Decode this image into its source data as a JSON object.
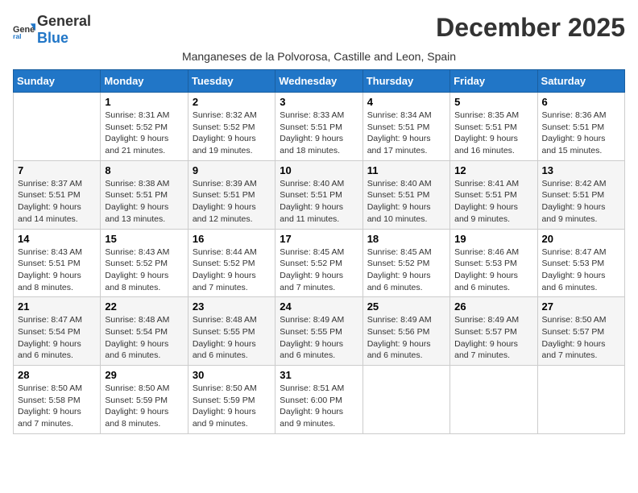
{
  "logo": {
    "general": "General",
    "blue": "Blue"
  },
  "title": "December 2025",
  "subtitle": "Manganeses de la Polvorosa, Castille and Leon, Spain",
  "days_header": [
    "Sunday",
    "Monday",
    "Tuesday",
    "Wednesday",
    "Thursday",
    "Friday",
    "Saturday"
  ],
  "weeks": [
    [
      {
        "day": "",
        "sunrise": "",
        "sunset": "",
        "daylight": ""
      },
      {
        "day": "1",
        "sunrise": "Sunrise: 8:31 AM",
        "sunset": "Sunset: 5:52 PM",
        "daylight": "Daylight: 9 hours and 21 minutes."
      },
      {
        "day": "2",
        "sunrise": "Sunrise: 8:32 AM",
        "sunset": "Sunset: 5:52 PM",
        "daylight": "Daylight: 9 hours and 19 minutes."
      },
      {
        "day": "3",
        "sunrise": "Sunrise: 8:33 AM",
        "sunset": "Sunset: 5:51 PM",
        "daylight": "Daylight: 9 hours and 18 minutes."
      },
      {
        "day": "4",
        "sunrise": "Sunrise: 8:34 AM",
        "sunset": "Sunset: 5:51 PM",
        "daylight": "Daylight: 9 hours and 17 minutes."
      },
      {
        "day": "5",
        "sunrise": "Sunrise: 8:35 AM",
        "sunset": "Sunset: 5:51 PM",
        "daylight": "Daylight: 9 hours and 16 minutes."
      },
      {
        "day": "6",
        "sunrise": "Sunrise: 8:36 AM",
        "sunset": "Sunset: 5:51 PM",
        "daylight": "Daylight: 9 hours and 15 minutes."
      }
    ],
    [
      {
        "day": "7",
        "sunrise": "Sunrise: 8:37 AM",
        "sunset": "Sunset: 5:51 PM",
        "daylight": "Daylight: 9 hours and 14 minutes."
      },
      {
        "day": "8",
        "sunrise": "Sunrise: 8:38 AM",
        "sunset": "Sunset: 5:51 PM",
        "daylight": "Daylight: 9 hours and 13 minutes."
      },
      {
        "day": "9",
        "sunrise": "Sunrise: 8:39 AM",
        "sunset": "Sunset: 5:51 PM",
        "daylight": "Daylight: 9 hours and 12 minutes."
      },
      {
        "day": "10",
        "sunrise": "Sunrise: 8:40 AM",
        "sunset": "Sunset: 5:51 PM",
        "daylight": "Daylight: 9 hours and 11 minutes."
      },
      {
        "day": "11",
        "sunrise": "Sunrise: 8:40 AM",
        "sunset": "Sunset: 5:51 PM",
        "daylight": "Daylight: 9 hours and 10 minutes."
      },
      {
        "day": "12",
        "sunrise": "Sunrise: 8:41 AM",
        "sunset": "Sunset: 5:51 PM",
        "daylight": "Daylight: 9 hours and 9 minutes."
      },
      {
        "day": "13",
        "sunrise": "Sunrise: 8:42 AM",
        "sunset": "Sunset: 5:51 PM",
        "daylight": "Daylight: 9 hours and 9 minutes."
      }
    ],
    [
      {
        "day": "14",
        "sunrise": "Sunrise: 8:43 AM",
        "sunset": "Sunset: 5:51 PM",
        "daylight": "Daylight: 9 hours and 8 minutes."
      },
      {
        "day": "15",
        "sunrise": "Sunrise: 8:43 AM",
        "sunset": "Sunset: 5:52 PM",
        "daylight": "Daylight: 9 hours and 8 minutes."
      },
      {
        "day": "16",
        "sunrise": "Sunrise: 8:44 AM",
        "sunset": "Sunset: 5:52 PM",
        "daylight": "Daylight: 9 hours and 7 minutes."
      },
      {
        "day": "17",
        "sunrise": "Sunrise: 8:45 AM",
        "sunset": "Sunset: 5:52 PM",
        "daylight": "Daylight: 9 hours and 7 minutes."
      },
      {
        "day": "18",
        "sunrise": "Sunrise: 8:45 AM",
        "sunset": "Sunset: 5:52 PM",
        "daylight": "Daylight: 9 hours and 6 minutes."
      },
      {
        "day": "19",
        "sunrise": "Sunrise: 8:46 AM",
        "sunset": "Sunset: 5:53 PM",
        "daylight": "Daylight: 9 hours and 6 minutes."
      },
      {
        "day": "20",
        "sunrise": "Sunrise: 8:47 AM",
        "sunset": "Sunset: 5:53 PM",
        "daylight": "Daylight: 9 hours and 6 minutes."
      }
    ],
    [
      {
        "day": "21",
        "sunrise": "Sunrise: 8:47 AM",
        "sunset": "Sunset: 5:54 PM",
        "daylight": "Daylight: 9 hours and 6 minutes."
      },
      {
        "day": "22",
        "sunrise": "Sunrise: 8:48 AM",
        "sunset": "Sunset: 5:54 PM",
        "daylight": "Daylight: 9 hours and 6 minutes."
      },
      {
        "day": "23",
        "sunrise": "Sunrise: 8:48 AM",
        "sunset": "Sunset: 5:55 PM",
        "daylight": "Daylight: 9 hours and 6 minutes."
      },
      {
        "day": "24",
        "sunrise": "Sunrise: 8:49 AM",
        "sunset": "Sunset: 5:55 PM",
        "daylight": "Daylight: 9 hours and 6 minutes."
      },
      {
        "day": "25",
        "sunrise": "Sunrise: 8:49 AM",
        "sunset": "Sunset: 5:56 PM",
        "daylight": "Daylight: 9 hours and 6 minutes."
      },
      {
        "day": "26",
        "sunrise": "Sunrise: 8:49 AM",
        "sunset": "Sunset: 5:57 PM",
        "daylight": "Daylight: 9 hours and 7 minutes."
      },
      {
        "day": "27",
        "sunrise": "Sunrise: 8:50 AM",
        "sunset": "Sunset: 5:57 PM",
        "daylight": "Daylight: 9 hours and 7 minutes."
      }
    ],
    [
      {
        "day": "28",
        "sunrise": "Sunrise: 8:50 AM",
        "sunset": "Sunset: 5:58 PM",
        "daylight": "Daylight: 9 hours and 7 minutes."
      },
      {
        "day": "29",
        "sunrise": "Sunrise: 8:50 AM",
        "sunset": "Sunset: 5:59 PM",
        "daylight": "Daylight: 9 hours and 8 minutes."
      },
      {
        "day": "30",
        "sunrise": "Sunrise: 8:50 AM",
        "sunset": "Sunset: 5:59 PM",
        "daylight": "Daylight: 9 hours and 9 minutes."
      },
      {
        "day": "31",
        "sunrise": "Sunrise: 8:51 AM",
        "sunset": "Sunset: 6:00 PM",
        "daylight": "Daylight: 9 hours and 9 minutes."
      },
      {
        "day": "",
        "sunrise": "",
        "sunset": "",
        "daylight": ""
      },
      {
        "day": "",
        "sunrise": "",
        "sunset": "",
        "daylight": ""
      },
      {
        "day": "",
        "sunrise": "",
        "sunset": "",
        "daylight": ""
      }
    ]
  ]
}
